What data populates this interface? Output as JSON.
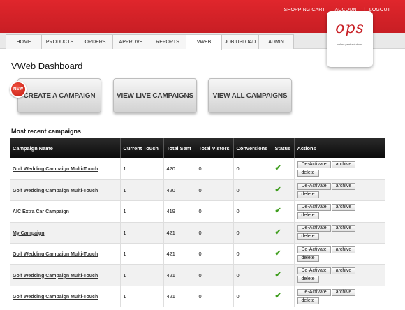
{
  "header": {
    "links": [
      {
        "label": "SHOPPING CART"
      },
      {
        "label": "ACCOUNT"
      },
      {
        "label": "LOGOUT"
      }
    ],
    "brand_color": "#d22128"
  },
  "nav": {
    "tabs": [
      {
        "label": "HOME"
      },
      {
        "label": "PRODUCTS"
      },
      {
        "label": "ORDERS"
      },
      {
        "label": "APPROVE"
      },
      {
        "label": "REPORTS"
      },
      {
        "label": "VWEB",
        "active": true
      },
      {
        "label": "JOB UPLOAD"
      },
      {
        "label": "ADMIN"
      }
    ]
  },
  "logo": {
    "mark": "ops",
    "tagline": "online print solutions"
  },
  "page": {
    "title": "VWeb Dashboard"
  },
  "buttons": {
    "badge": "NEW",
    "create": "CREATE A CAMPAIGN",
    "live": "VIEW LIVE CAMPAIGNS",
    "all": "VIEW ALL CAMPAIGNS"
  },
  "recent": {
    "title": "Most recent campaigns",
    "columns": [
      "Campaign Name",
      "Current Touch",
      "Total Sent",
      "Total Vistors",
      "Conversions",
      "Status",
      "Actions"
    ],
    "status_icon": "check-icon",
    "status_glyph": "✔",
    "actions": {
      "deactivate": "De-Activate",
      "archive": "archive",
      "delete": "delete"
    },
    "rows": [
      {
        "name": "Golf Wedding Campaign Multi-Touch",
        "touch": "1",
        "sent": "420",
        "visitors": "0",
        "conversions": "0"
      },
      {
        "name": "Golf Wedding Campaign Multi-Touch",
        "touch": "1",
        "sent": "420",
        "visitors": "0",
        "conversions": "0"
      },
      {
        "name": "AIC Extra Car Campaign",
        "touch": "1",
        "sent": "419",
        "visitors": "0",
        "conversions": "0"
      },
      {
        "name": "My Campaign",
        "touch": "1",
        "sent": "421",
        "visitors": "0",
        "conversions": "0"
      },
      {
        "name": "Golf Wedding Campaign Multi-Touch",
        "touch": "1",
        "sent": "421",
        "visitors": "0",
        "conversions": "0"
      },
      {
        "name": "Golf Wedding Campaign Multi-Touch",
        "touch": "1",
        "sent": "421",
        "visitors": "0",
        "conversions": "0"
      },
      {
        "name": "Golf Wedding Campaign Multi-Touch",
        "touch": "1",
        "sent": "421",
        "visitors": "0",
        "conversions": "0"
      }
    ]
  }
}
